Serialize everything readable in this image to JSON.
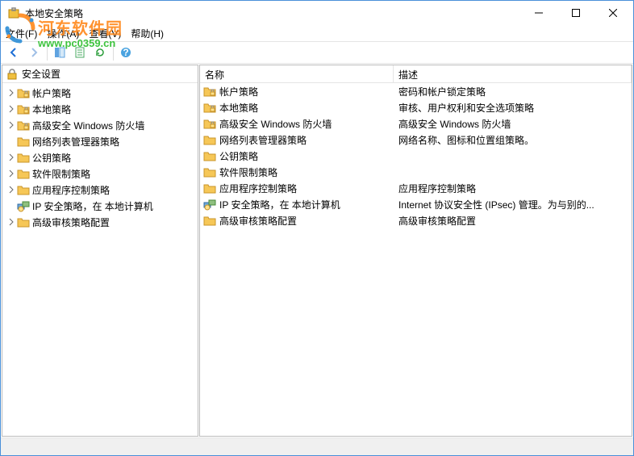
{
  "window": {
    "title": "本地安全策略"
  },
  "menu": {
    "file": "文件(F)",
    "action": "操作(A)",
    "view": "查看(V)",
    "help": "帮助(H)"
  },
  "tree": {
    "root": "安全设置",
    "items": [
      {
        "label": "帐户策略",
        "icon": "folder-lock",
        "expand": true
      },
      {
        "label": "本地策略",
        "icon": "folder-lock",
        "expand": true
      },
      {
        "label": "高级安全 Windows 防火墙",
        "icon": "folder-lock",
        "expand": true
      },
      {
        "label": "网络列表管理器策略",
        "icon": "folder",
        "expand": false
      },
      {
        "label": "公钥策略",
        "icon": "folder",
        "expand": true
      },
      {
        "label": "软件限制策略",
        "icon": "folder",
        "expand": true
      },
      {
        "label": "应用程序控制策略",
        "icon": "folder",
        "expand": true
      },
      {
        "label": "IP 安全策略，在 本地计算机",
        "icon": "ipsec",
        "expand": false
      },
      {
        "label": "高级审核策略配置",
        "icon": "folder",
        "expand": true
      }
    ]
  },
  "list": {
    "header_name": "名称",
    "header_desc": "描述",
    "rows": [
      {
        "name": "帐户策略",
        "desc": "密码和帐户锁定策略",
        "icon": "folder-lock"
      },
      {
        "name": "本地策略",
        "desc": "审核、用户权利和安全选项策略",
        "icon": "folder-lock"
      },
      {
        "name": "高级安全 Windows 防火墙",
        "desc": "高级安全 Windows 防火墙",
        "icon": "folder-lock"
      },
      {
        "name": "网络列表管理器策略",
        "desc": "网络名称、图标和位置组策略。",
        "icon": "folder"
      },
      {
        "name": "公钥策略",
        "desc": "",
        "icon": "folder"
      },
      {
        "name": "软件限制策略",
        "desc": "",
        "icon": "folder"
      },
      {
        "name": "应用程序控制策略",
        "desc": "应用程序控制策略",
        "icon": "folder"
      },
      {
        "name": "IP 安全策略，在 本地计算机",
        "desc": "Internet 协议安全性 (IPsec) 管理。为与别的...",
        "icon": "ipsec"
      },
      {
        "name": "高级审核策略配置",
        "desc": "高级审核策略配置",
        "icon": "folder"
      }
    ]
  },
  "watermark": {
    "text": "河东软件园",
    "url": "www.pc0359.cn"
  }
}
